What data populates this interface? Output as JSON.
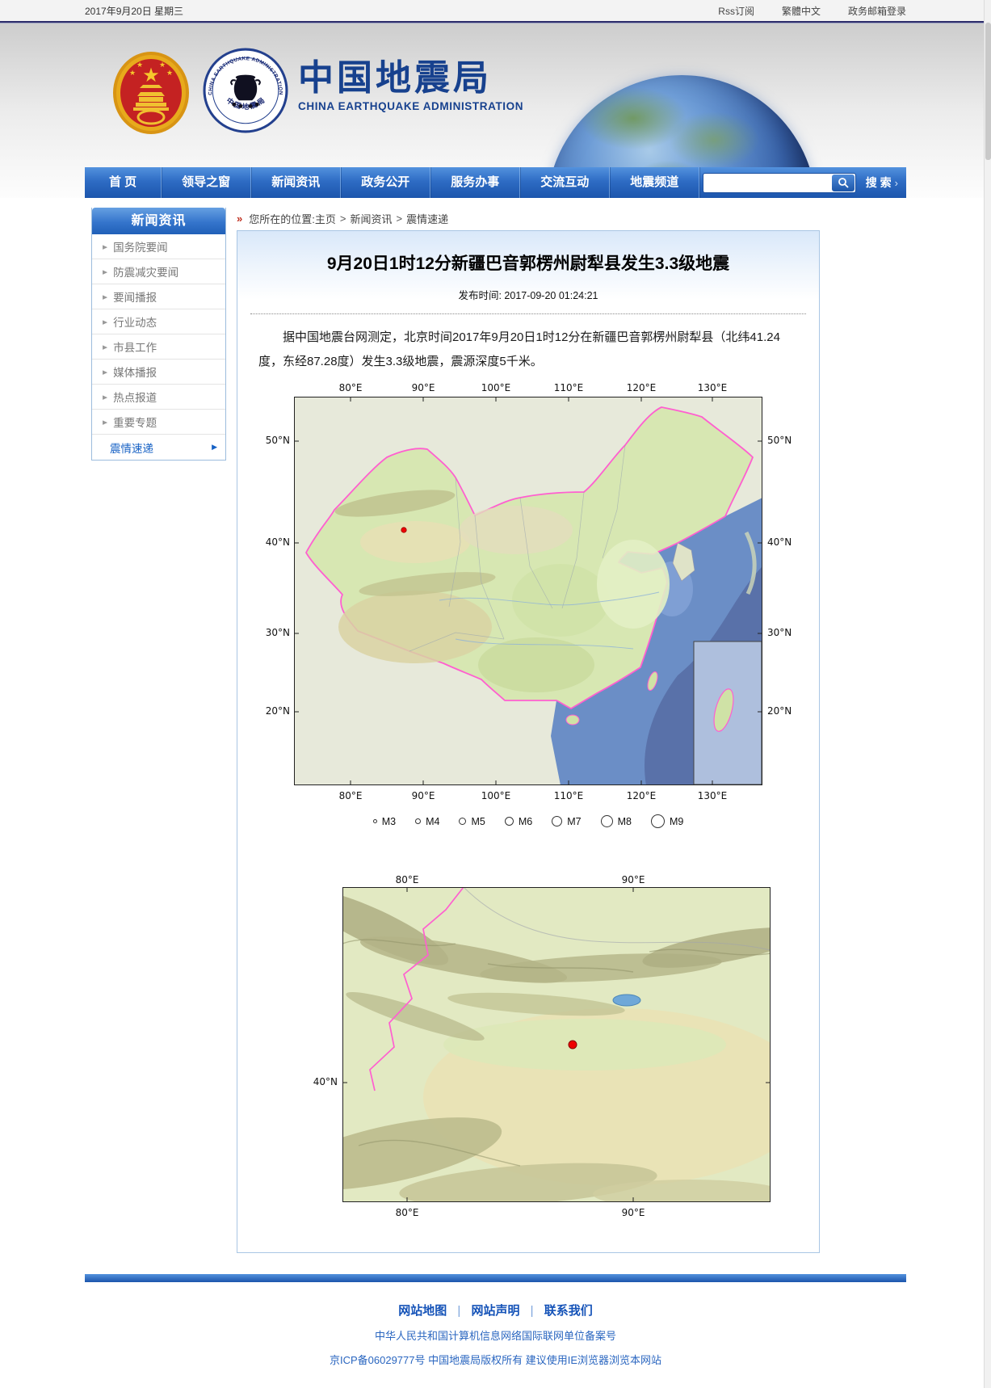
{
  "topbar": {
    "date": "2017年9月20日  星期三",
    "links": [
      "Rss订阅",
      "繁體中文",
      "政务邮箱登录"
    ]
  },
  "header": {
    "site_cn": "中国地震局",
    "site_en": "CHINA EARTHQUAKE ADMINISTRATION",
    "seal_top": "CHINA EARTHQUAKE ADMINISTRATION",
    "seal_bottom": "中 国 地 震 局"
  },
  "nav": {
    "items": [
      "首 页",
      "领导之窗",
      "新闻资讯",
      "政务公开",
      "服务办事",
      "交流互动",
      "地震频道"
    ],
    "search_value": "",
    "search_label": "搜 索"
  },
  "icons": {
    "chevron_right": "▶",
    "breadcrumb_marker": "»",
    "search_arrow": "›"
  },
  "sidebar": {
    "title": "新闻资讯",
    "items": [
      "国务院要闻",
      "防震减灾要闻",
      "要闻播报",
      "行业动态",
      "市县工作",
      "媒体播报",
      "热点报道",
      "重要专题"
    ],
    "active": "震情速递"
  },
  "breadcrumb": {
    "prefix": "您所在的位置:",
    "sep": ">",
    "parts": [
      "主页",
      "新闻资讯",
      "震情速递"
    ]
  },
  "article": {
    "title": "9月20日1时12分新疆巴音郭楞州尉犁县发生3.3级地震",
    "publish": "发布时间: 2017-09-20 01:24:21",
    "body": "据中国地震台网测定，北京时间2017年9月20日1时12分在新疆巴音郭楞州尉犁县（北纬41.24度，东经87.28度）发生3.3级地震，震源深度5千米。"
  },
  "map_national": {
    "top_labels": [
      "80°E",
      "90°E",
      "100°E",
      "110°E",
      "120°E",
      "130°E"
    ],
    "bottom_labels": [
      "80°E",
      "90°E",
      "100°E",
      "110°E",
      "120°E",
      "130°E"
    ],
    "left_labels": [
      "50°N",
      "40°N",
      "30°N",
      "20°N"
    ],
    "right_labels": [
      "50°N",
      "40°N",
      "30°N",
      "20°N"
    ],
    "legend": [
      "M3",
      "M4",
      "M5",
      "M6",
      "M7",
      "M8",
      "M9"
    ]
  },
  "map_region": {
    "top_labels": [
      "80°E",
      "90°E"
    ],
    "bottom_labels": [
      "80°E",
      "90°E"
    ],
    "left_labels": [
      "40°N"
    ]
  },
  "footer": {
    "links": [
      "网站地图",
      "网站声明",
      "联系我们"
    ],
    "sep": "|",
    "record_line": "中华人民共和国计算机信息网络国际联网单位备案号",
    "copyright_line": "京ICP备06029777号  中国地震局版权所有  建议使用IE浏览器浏览本网站"
  },
  "colors": {
    "nav_blue": "#2e6cc4",
    "link_blue": "#1553b8",
    "breadcrumb_red": "#c03020",
    "epicenter_red": "#ee0000",
    "boundary_magenta": "#ff5fd0"
  }
}
